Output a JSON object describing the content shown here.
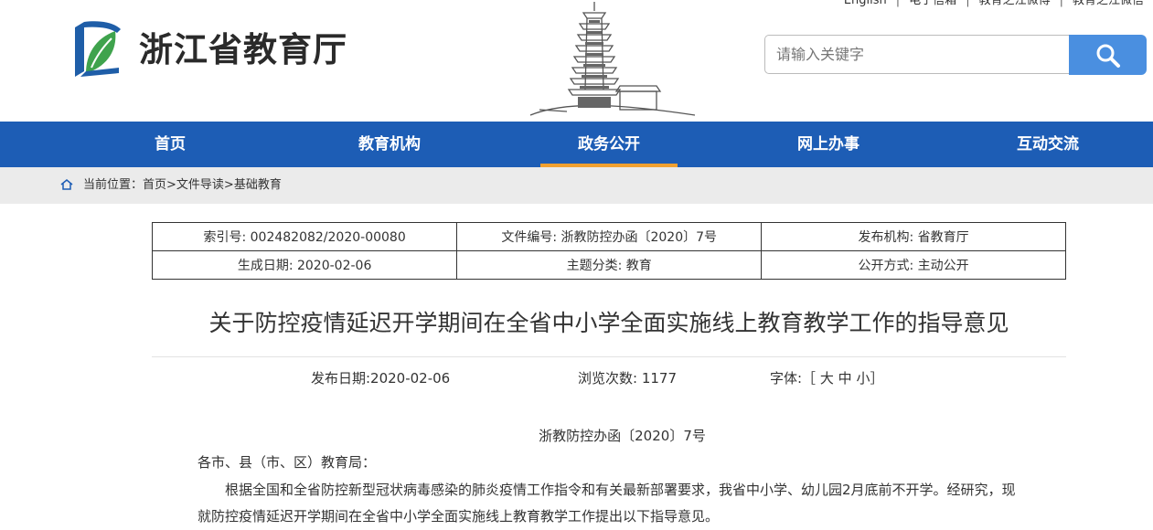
{
  "top_links": [
    "English",
    "电子信箱",
    "教育之江微博",
    "教育之江微信"
  ],
  "site": {
    "name": "浙江省教育厅"
  },
  "search": {
    "placeholder": "请输入关键字"
  },
  "nav": [
    {
      "label": "首页",
      "active": false
    },
    {
      "label": "教育机构",
      "active": false
    },
    {
      "label": "政务公开",
      "active": true
    },
    {
      "label": "网上办事",
      "active": false
    },
    {
      "label": "互动交流",
      "active": false
    }
  ],
  "breadcrumb": {
    "prefix": "当前位置：",
    "items": [
      "首页>",
      "文件导读>",
      "基础教育"
    ]
  },
  "info": {
    "index": "索引号: 002482082/2020-00080",
    "doc_no": "文件编号: 浙教防控办函〔2020〕7号",
    "publisher": "发布机构: 省教育厅",
    "created": "生成日期: 2020-02-06",
    "category": "主题分类: 教育",
    "open_mode": "公开方式: 主动公开"
  },
  "article": {
    "title": "关于防控疫情延迟开学期间在全省中小学全面实施线上教育教学工作的指导意见",
    "publish_date": "发布日期:2020-02-06",
    "views": "浏览次数: 1177",
    "font_label": "字体:［",
    "font_large": "大",
    "font_medium": "中",
    "font_small": "小",
    "font_close": "］",
    "doc_number": "浙教防控办函〔2020〕7号",
    "salutation": "各市、县（市、区）教育局：",
    "paragraph": "根据全国和全省防控新型冠状病毒感染的肺炎疫情工作指令和有关最新部署要求，我省中小学、幼儿园2月底前不开学。经研究，现就防控疫情延迟开学期间在全省中小学全面实施线上教育教学工作提出以下指导意见。"
  },
  "colors": {
    "nav_bg": "#1d5db5",
    "nav_active_underline": "#f0a030",
    "search_button": "#4a8fe0",
    "breadcrumb_bg": "#ebebeb",
    "logo_blue": "#1f5ea8",
    "logo_green": "#3fa34d"
  }
}
